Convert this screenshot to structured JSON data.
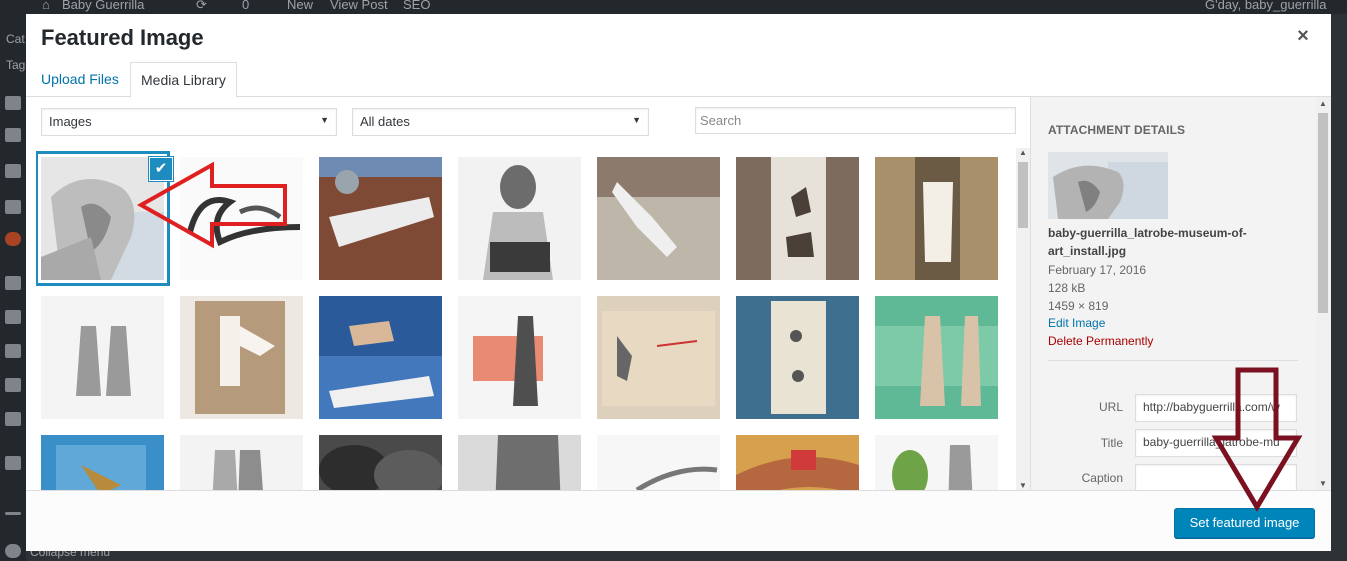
{
  "adminbar": {
    "site_name": "Baby Guerrilla",
    "comments_count": "0",
    "new_label": "New",
    "view_post_label": "View Post",
    "seo_label": "SEO",
    "greeting": "G'day, baby_guerrilla"
  },
  "adminmenu": {
    "items": [
      "Cat",
      "Tag"
    ],
    "collapse_label": "Collapse menu"
  },
  "modal": {
    "title": "Featured Image",
    "close_glyph": "×",
    "tabs": [
      "Upload Files",
      "Media Library"
    ]
  },
  "toolbar": {
    "type_filter": "Images",
    "date_filter": "All dates",
    "search_placeholder": "Search",
    "dropdown_glyph": "▼"
  },
  "grid": {
    "selected_index": 0,
    "check_glyph": "✔",
    "items": [
      {
        "subject": "pencil drawing of man at window"
      },
      {
        "subject": "Guerrilla script lettering"
      },
      {
        "subject": "mural on brick building"
      },
      {
        "subject": "woman with lettered dress"
      },
      {
        "subject": "cutout figure on wall"
      },
      {
        "subject": "moths in shadow box"
      },
      {
        "subject": "plaster torso in wooden frame"
      },
      {
        "subject": "two walking soldiers sketch"
      },
      {
        "subject": "cutout woman in cardboard"
      },
      {
        "subject": "and the band played on record"
      },
      {
        "subject": "man with rifle cutout"
      },
      {
        "subject": "old envelope with figure"
      },
      {
        "subject": "insect specimen on blue"
      },
      {
        "subject": "figures on green card"
      },
      {
        "subject": "lizard in blue frame"
      },
      {
        "subject": "couple pencil sketch"
      },
      {
        "subject": "black plastic bags"
      },
      {
        "subject": "man in suit drawing"
      },
      {
        "subject": "fallen figure sketch"
      },
      {
        "subject": "swimmer painting"
      },
      {
        "subject": "leaves and figure"
      }
    ]
  },
  "details": {
    "heading": "ATTACHMENT DETAILS",
    "filename": "baby-guerrilla_latrobe-museum-of-art_install.jpg",
    "date": "February 17, 2016",
    "size": "128 kB",
    "dimensions": "1459 × 819",
    "edit_label": "Edit Image",
    "delete_label": "Delete Permanently",
    "fields": {
      "url_label": "URL",
      "url_value": "http://babyguerrilla.com/w",
      "title_label": "Title",
      "title_value": "baby-guerrilla_latrobe-mu",
      "caption_label": "Caption",
      "caption_value": ""
    }
  },
  "footer": {
    "button_label": "Set featured image"
  },
  "colors": {
    "accent": "#0085ba",
    "selection": "#1e8cbe",
    "delete": "#aa0000",
    "annotation_red": "#e02020",
    "annotation_maroon": "#7a1020"
  },
  "icons": [
    "close-icon",
    "checkmark-icon",
    "dropdown-arrow-icon",
    "scroll-up-icon",
    "scroll-down-icon",
    "red-arrow-annotation",
    "down-arrow-annotation"
  ]
}
